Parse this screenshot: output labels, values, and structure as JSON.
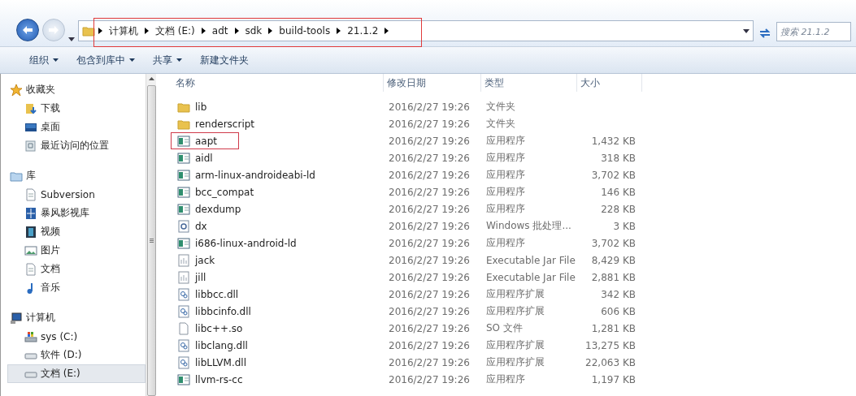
{
  "address_bar": {
    "crumbs": [
      "计算机",
      "文档 (E:)",
      "adt",
      "sdk",
      "build-tools",
      "21.1.2"
    ],
    "highlighted": true
  },
  "search": {
    "placeholder": "搜索 21.1.2"
  },
  "toolbar": [
    {
      "label": "组织",
      "dropdown": true
    },
    {
      "label": "包含到库中",
      "dropdown": true
    },
    {
      "label": "共享",
      "dropdown": true
    },
    {
      "label": "新建文件夹",
      "dropdown": false
    }
  ],
  "sidebar": {
    "groups": [
      {
        "label": "收藏夹",
        "children": [
          {
            "label": "下载",
            "selected": false
          },
          {
            "label": "桌面",
            "selected": false
          },
          {
            "label": "最近访问的位置",
            "selected": false
          }
        ]
      },
      {
        "label": "库",
        "children": [
          {
            "label": "Subversion",
            "selected": false
          },
          {
            "label": "暴风影视库",
            "selected": false
          },
          {
            "label": "视频",
            "selected": false
          },
          {
            "label": "图片",
            "selected": false
          },
          {
            "label": "文档",
            "selected": false
          },
          {
            "label": "音乐",
            "selected": false
          }
        ]
      },
      {
        "label": "计算机",
        "children": [
          {
            "label": "sys (C:)",
            "selected": false
          },
          {
            "label": "软件 (D:)",
            "selected": false
          },
          {
            "label": "文档 (E:)",
            "selected": true
          }
        ]
      }
    ]
  },
  "table": {
    "columns": [
      "名称",
      "修改日期",
      "类型",
      "大小"
    ],
    "rows": [
      {
        "kind": "folder",
        "name": "lib",
        "date": "2016/2/27 19:26",
        "type": "文件夹",
        "size": "",
        "highlighted": false
      },
      {
        "kind": "folder",
        "name": "renderscript",
        "date": "2016/2/27 19:26",
        "type": "文件夹",
        "size": "",
        "highlighted": false
      },
      {
        "kind": "exe",
        "name": "aapt",
        "date": "2016/2/27 19:26",
        "type": "应用程序",
        "size": "1,432 KB",
        "highlighted": true
      },
      {
        "kind": "exe",
        "name": "aidl",
        "date": "2016/2/27 19:26",
        "type": "应用程序",
        "size": "318 KB",
        "highlighted": false
      },
      {
        "kind": "exe",
        "name": "arm-linux-androideabi-ld",
        "date": "2016/2/27 19:26",
        "type": "应用程序",
        "size": "3,702 KB",
        "highlighted": false
      },
      {
        "kind": "exe",
        "name": "bcc_compat",
        "date": "2016/2/27 19:26",
        "type": "应用程序",
        "size": "146 KB",
        "highlighted": false
      },
      {
        "kind": "exe",
        "name": "dexdump",
        "date": "2016/2/27 19:26",
        "type": "应用程序",
        "size": "228 KB",
        "highlighted": false
      },
      {
        "kind": "batch",
        "name": "dx",
        "date": "2016/2/27 19:26",
        "type": "Windows 批处理...",
        "size": "3 KB",
        "highlighted": false
      },
      {
        "kind": "exe",
        "name": "i686-linux-android-ld",
        "date": "2016/2/27 19:26",
        "type": "应用程序",
        "size": "3,702 KB",
        "highlighted": false
      },
      {
        "kind": "jar",
        "name": "jack",
        "date": "2016/2/27 19:26",
        "type": "Executable Jar File",
        "size": "8,429 KB",
        "highlighted": false
      },
      {
        "kind": "jar",
        "name": "jill",
        "date": "2016/2/27 19:26",
        "type": "Executable Jar File",
        "size": "2,881 KB",
        "highlighted": false
      },
      {
        "kind": "dll",
        "name": "libbcc.dll",
        "date": "2016/2/27 19:26",
        "type": "应用程序扩展",
        "size": "342 KB",
        "highlighted": false
      },
      {
        "kind": "dll",
        "name": "libbcinfo.dll",
        "date": "2016/2/27 19:26",
        "type": "应用程序扩展",
        "size": "606 KB",
        "highlighted": false
      },
      {
        "kind": "file",
        "name": "libc++.so",
        "date": "2016/2/27 19:26",
        "type": "SO 文件",
        "size": "1,281 KB",
        "highlighted": false
      },
      {
        "kind": "dll",
        "name": "libclang.dll",
        "date": "2016/2/27 19:26",
        "type": "应用程序扩展",
        "size": "13,275 KB",
        "highlighted": false
      },
      {
        "kind": "dll",
        "name": "libLLVM.dll",
        "date": "2016/2/27 19:26",
        "type": "应用程序扩展",
        "size": "22,063 KB",
        "highlighted": false
      },
      {
        "kind": "exe",
        "name": "llvm-rs-cc",
        "date": "2016/2/27 19:26",
        "type": "应用程序",
        "size": "1,197 KB",
        "highlighted": false
      }
    ]
  }
}
